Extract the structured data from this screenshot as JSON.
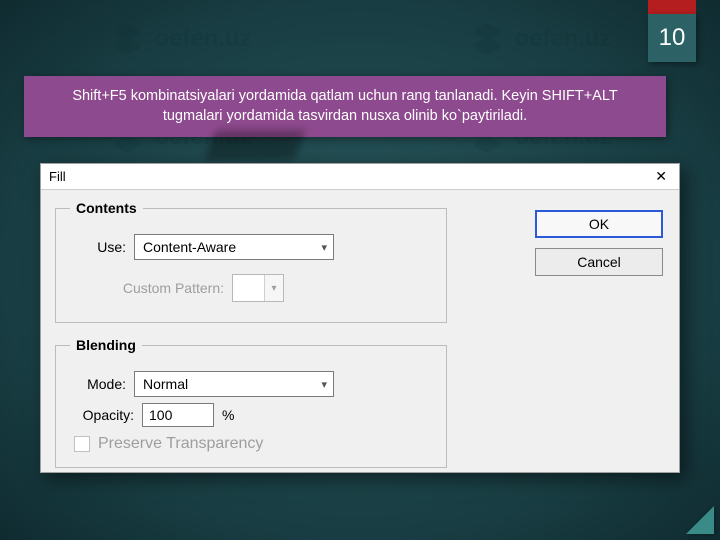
{
  "page_number": "10",
  "caption": "Shift+F5 kombinatsiyalari yordamida qatlam uchun rang tanlanadi. Keyin SHIFT+ALT tugmalari yordamida tasvirdan nusxa olinib ko`paytiriladi.",
  "watermark": "oefen.uz",
  "dialog": {
    "title": "Fill",
    "contents": {
      "legend": "Contents",
      "use_label": "Use:",
      "use_value": "Content-Aware",
      "pattern_label": "Custom Pattern:"
    },
    "blending": {
      "legend": "Blending",
      "mode_label": "Mode:",
      "mode_value": "Normal",
      "opacity_label": "Opacity:",
      "opacity_value": "100",
      "opacity_unit": "%",
      "preserve_label": "Preserve Transparency"
    },
    "buttons": {
      "ok": "OK",
      "cancel": "Cancel"
    }
  }
}
